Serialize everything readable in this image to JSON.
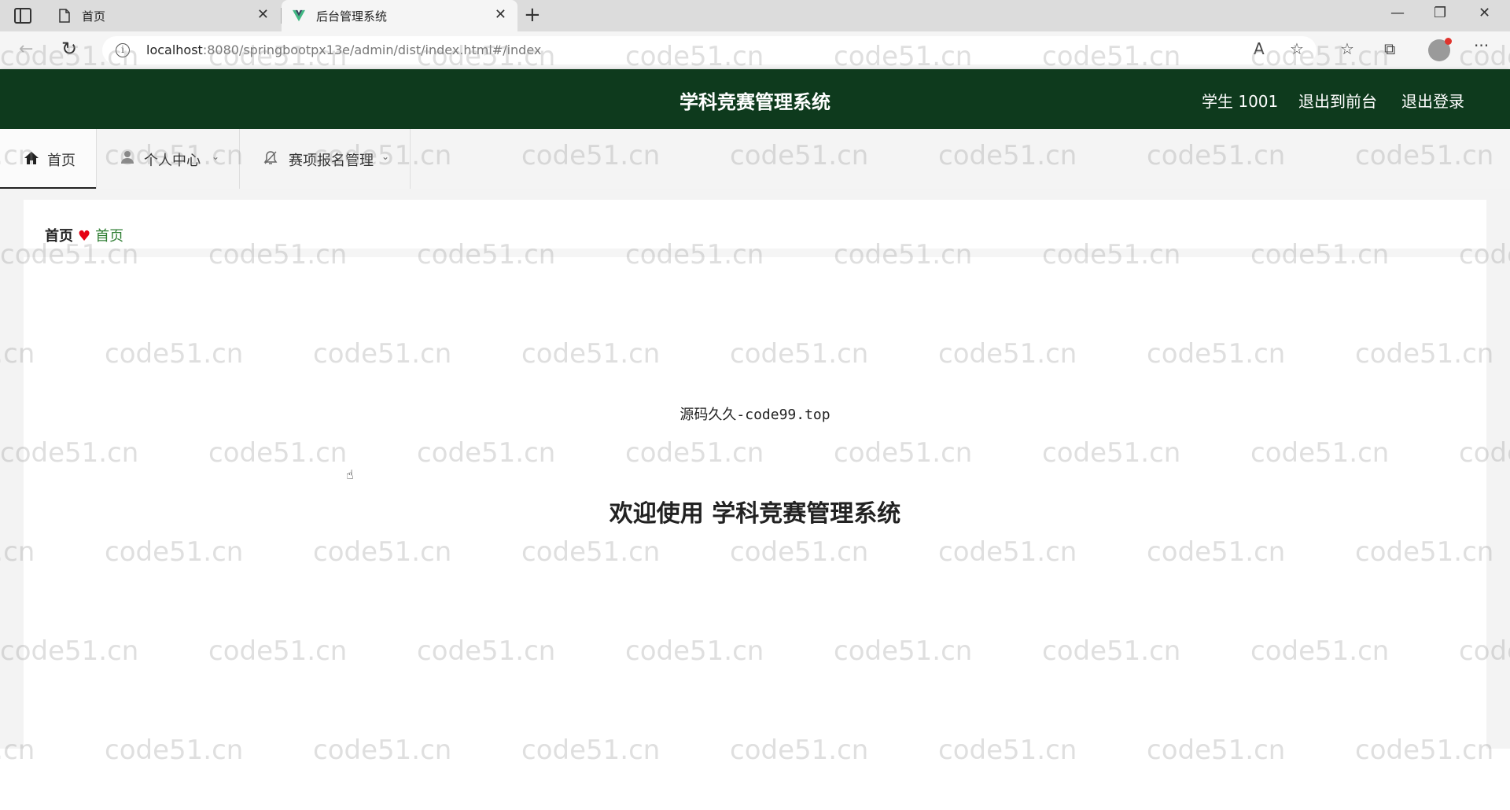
{
  "browser": {
    "tabs": [
      {
        "title": "首页",
        "icon": "page-icon",
        "close": "✕"
      },
      {
        "title": "后台管理系统",
        "icon": "vue-icon",
        "close": "✕"
      }
    ],
    "new_tab_label": "+",
    "url_host": "localhost",
    "url_rest": ":8080/springbootpx13e/admin/dist/index.html#/index",
    "toolbar_icons": [
      "read-aloud-icon",
      "add-favorite-icon",
      "favorites-icon",
      "collections-icon",
      "profile-icon",
      "more-icon"
    ]
  },
  "header": {
    "title": "学科竞赛管理系统",
    "user_label": "学生 1001",
    "to_frontend": "退出到前台",
    "logout": "退出登录"
  },
  "nav": {
    "items": [
      {
        "label": "首页",
        "icon": "home-icon"
      },
      {
        "label": "个人中心",
        "icon": "user-icon"
      },
      {
        "label": "赛项报名管理",
        "icon": "bell-icon"
      }
    ]
  },
  "breadcrumb": {
    "first": "首页",
    "second": "首页"
  },
  "main": {
    "source_text": "源码久久-code99.top",
    "welcome": "欢迎使用 学科竞赛管理系统"
  },
  "watermark": {
    "text": "code51.cn"
  },
  "colors": {
    "header_bg": "#0e3a1d",
    "breadcrumb_active": "#2e7d32",
    "heart": "#e60012"
  }
}
